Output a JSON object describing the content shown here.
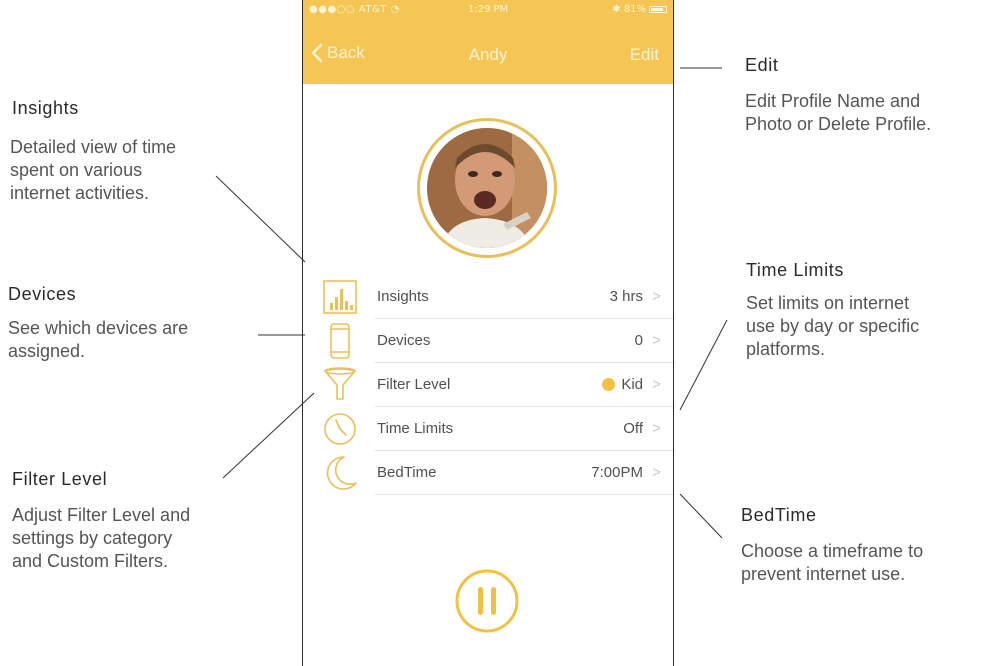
{
  "status_bar": {
    "carrier": "●●●○○ AT&T ◔",
    "time": "1:29 PM",
    "battery": "✱ 81%"
  },
  "nav": {
    "back_label": "Back",
    "title": "Andy",
    "edit_label": "Edit"
  },
  "menu": [
    {
      "label": "Insights",
      "value": "3 hrs",
      "icon": "bar-chart-icon"
    },
    {
      "label": "Devices",
      "value": "0",
      "icon": "phone-device-icon"
    },
    {
      "label": "Filter Level",
      "value": "Kid",
      "icon": "funnel-filter-icon",
      "dot_color": "#f2c043"
    },
    {
      "label": "Time Limits",
      "value": "Off",
      "icon": "clock-icon"
    },
    {
      "label": "BedTime",
      "value": "7:00PM",
      "icon": "moon-icon"
    }
  ],
  "chevron": ">",
  "annotations": {
    "edit": {
      "title": "Edit",
      "body": [
        "Edit Profile Name and",
        "Photo or Delete Profile."
      ]
    },
    "insights": {
      "title": "Insights",
      "body": [
        "Detailed view of time",
        "spent on various",
        "internet activities."
      ]
    },
    "devices": {
      "title": "Devices",
      "body": [
        "See which devices are",
        "assigned."
      ]
    },
    "time_limits": {
      "title": "Time Limits",
      "body": [
        "Set limits on internet",
        "use by day or specific",
        "platforms."
      ]
    },
    "filter_level": {
      "title": "Filter Level",
      "body": [
        "Adjust Filter Level and",
        "settings by category",
        "and Custom Filters."
      ]
    },
    "bedtime": {
      "title": "BedTime",
      "body": [
        "Choose a timeframe to",
        "prevent internet use."
      ]
    }
  },
  "colors": {
    "accent": "#f5c654",
    "icon_gold": "#e9bf5a",
    "text": "#505050"
  }
}
